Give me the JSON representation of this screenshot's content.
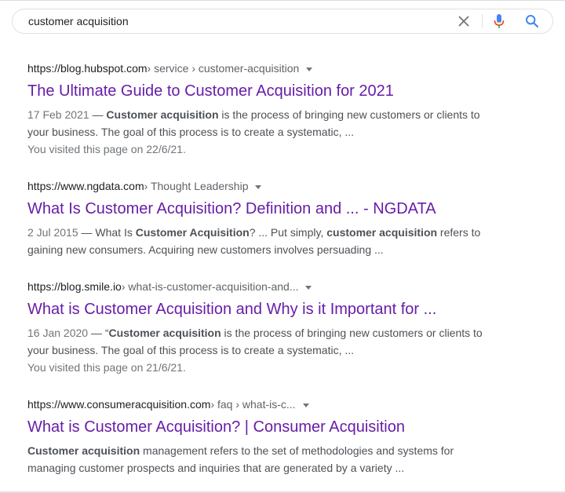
{
  "search": {
    "query": "customer acquisition",
    "clear_icon": "close-icon",
    "mic_icon": "microphone-icon",
    "search_icon": "search-icon"
  },
  "colors": {
    "visited_link": "#681da8",
    "snippet_text": "#4d5156",
    "cite_path": "#5f6368",
    "mic_blue": "#4285f4",
    "mic_red": "#ea4335",
    "search_blue": "#4285f4"
  },
  "results": [
    {
      "domain": "https://blog.hubspot.com",
      "path": " › service › customer-acquisition",
      "title": "The Ultimate Guide to Customer Acquisition for 2021",
      "snippet": {
        "date": "17 Feb 2021",
        "dash": " — ",
        "line1_bold1": "Customer acquisition",
        "line1_rest": " is the process of bringing new customers or clients to",
        "line2": "your business. The goal of this process is to create a systematic, ..."
      },
      "visited": "You visited this page on 22/6/21."
    },
    {
      "domain": "https://www.ngdata.com",
      "path": " › Thought Leadership",
      "title": "What Is Customer Acquisition? Definition and ... - NGDATA",
      "snippet": {
        "date": "2 Jul 2015",
        "dash": " — ",
        "pre": "What Is ",
        "bold1": "Customer Acquisition",
        "mid": "? ... Put simply, ",
        "bold2": "customer acquisition",
        "post": " refers to",
        "line2": "gaining new consumers. Acquiring new customers involves persuading ..."
      }
    },
    {
      "domain": "https://blog.smile.io",
      "path": " › what-is-customer-acquisition-and...",
      "title": "What is Customer Acquisition and Why is it Important for ...",
      "snippet": {
        "date": "16 Jan 2020",
        "dash": " — “",
        "bold1": "Customer acquisition",
        "rest": " is the process of bringing new customers or clients to",
        "line2": "your business. The goal of this process is to create a systematic, ..."
      },
      "visited": "You visited this page on 21/6/21."
    },
    {
      "domain": "https://www.consumeracquisition.com",
      "path": " › faq › what-is-c...",
      "title": "What is Customer Acquisition? | Consumer Acquisition",
      "snippet": {
        "bold1": "Customer acquisition",
        "rest": " management refers to the set of methodologies and systems for",
        "line2": "managing customer prospects and inquiries that are generated by a variety ..."
      }
    }
  ]
}
